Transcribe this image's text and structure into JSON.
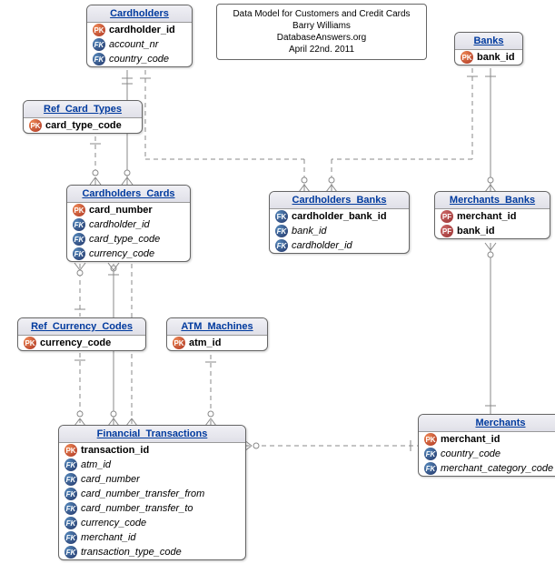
{
  "title_box": {
    "line1": "Data Model  for Customers and Credit Cards",
    "line2": "Barry Williams",
    "line3": "DatabaseAnswers.org",
    "line4": "April 22nd. 2011"
  },
  "entities": {
    "cardholders": {
      "name": "Cardholders",
      "attrs": [
        {
          "key": "PK",
          "label": "cardholder_id",
          "style": "bold"
        },
        {
          "key": "FK",
          "label": "account_nr",
          "style": "italic"
        },
        {
          "key": "FK",
          "label": "country_code",
          "style": "italic"
        }
      ]
    },
    "banks": {
      "name": "Banks",
      "attrs": [
        {
          "key": "PK",
          "label": "bank_id",
          "style": "bold"
        }
      ]
    },
    "ref_card_types": {
      "name": "Ref_Card_Types",
      "attrs": [
        {
          "key": "PK",
          "label": "card_type_code",
          "style": "bold"
        }
      ]
    },
    "cardholders_cards": {
      "name": "Cardholders_Cards",
      "attrs": [
        {
          "key": "PK",
          "label": "card_number",
          "style": "bold"
        },
        {
          "key": "FK",
          "label": "cardholder_id",
          "style": "italic"
        },
        {
          "key": "FK",
          "label": "card_type_code",
          "style": "italic"
        },
        {
          "key": "FK",
          "label": "currency_code",
          "style": "italic"
        }
      ]
    },
    "cardholders_banks": {
      "name": "Cardholders_Banks",
      "attrs": [
        {
          "key": "FK",
          "label": "cardholder_bank_id",
          "style": "bold"
        },
        {
          "key": "FK",
          "label": "bank_id",
          "style": "italic"
        },
        {
          "key": "FK",
          "label": "cardholder_id",
          "style": "italic"
        }
      ]
    },
    "merchants_banks": {
      "name": "Merchants_Banks",
      "attrs": [
        {
          "key": "PF",
          "label": "merchant_id",
          "style": "bold"
        },
        {
          "key": "PF",
          "label": "bank_id",
          "style": "bold"
        }
      ]
    },
    "ref_currency_codes": {
      "name": "Ref_Currency_Codes",
      "attrs": [
        {
          "key": "PK",
          "label": "currency_code",
          "style": "bold"
        }
      ]
    },
    "atm_machines": {
      "name": "ATM_Machines",
      "attrs": [
        {
          "key": "PK",
          "label": "atm_id",
          "style": "bold"
        }
      ]
    },
    "financial_transactions": {
      "name": "Financial_Transactions",
      "attrs": [
        {
          "key": "PK",
          "label": "transaction_id",
          "style": "bold"
        },
        {
          "key": "FK",
          "label": "atm_id",
          "style": "italic"
        },
        {
          "key": "FK",
          "label": "card_number",
          "style": "italic"
        },
        {
          "key": "FK",
          "label": "card_number_transfer_from",
          "style": "italic"
        },
        {
          "key": "FK",
          "label": "card_number_transfer_to",
          "style": "italic"
        },
        {
          "key": "FK",
          "label": "currency_code",
          "style": "italic"
        },
        {
          "key": "FK",
          "label": "merchant_id",
          "style": "italic"
        },
        {
          "key": "FK",
          "label": "transaction_type_code",
          "style": "italic"
        }
      ]
    },
    "merchants": {
      "name": "Merchants",
      "attrs": [
        {
          "key": "PK",
          "label": "merchant_id",
          "style": "bold"
        },
        {
          "key": "FK",
          "label": "country_code",
          "style": "italic"
        },
        {
          "key": "FK",
          "label": "merchant_category_code",
          "style": "italic"
        }
      ]
    }
  }
}
